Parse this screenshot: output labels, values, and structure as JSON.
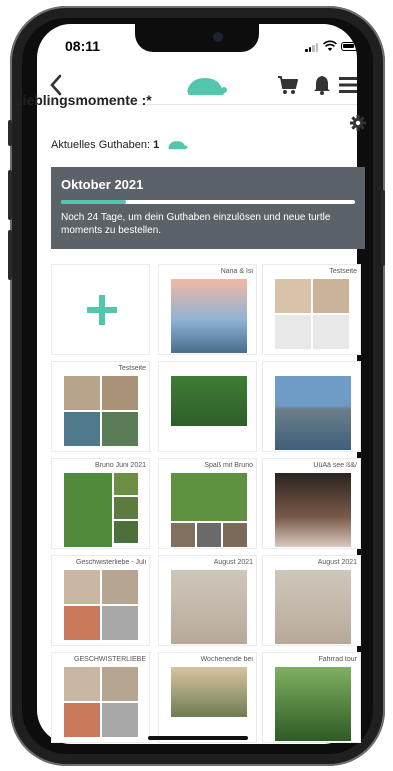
{
  "status_bar": {
    "time": "08:11"
  },
  "header": {
    "back_icon": "chevron-left-icon",
    "logo": "turtle-logo",
    "cart_icon": "cart-icon",
    "bell_icon": "bell-icon",
    "menu_icon": "menu-icon"
  },
  "page": {
    "title": "Lieblingsmomente :*",
    "credits_label": "Aktuelles Guthaben:",
    "credits_value": "1"
  },
  "banner": {
    "title": "Oktober 2021",
    "progress_fraction": 0.22,
    "text": "Noch 24 Tage, um dein Guthaben einzulösen und neue turtle moments zu bestellen."
  },
  "tiles": [
    {
      "label": ""
    },
    {
      "label": "Nana & Isi"
    },
    {
      "label": "Testseite"
    },
    {
      "label": "Testseite"
    },
    {
      "label": ""
    },
    {
      "label": ""
    },
    {
      "label": "Bruno Juni 2021"
    },
    {
      "label": "Spaß mit Bruno"
    },
    {
      "label": "ÜüÄä see ß&/"
    },
    {
      "label": "Geschwisterliebe - Juli"
    },
    {
      "label": "August 2021"
    },
    {
      "label": "August 2021"
    },
    {
      "label": "GESCHWISTERLIEBE"
    },
    {
      "label": "Wochenende bei"
    },
    {
      "label": "Fahrrad tour"
    }
  ],
  "colors": {
    "accent": "#52c7ad",
    "banner_bg": "#5c6368"
  }
}
